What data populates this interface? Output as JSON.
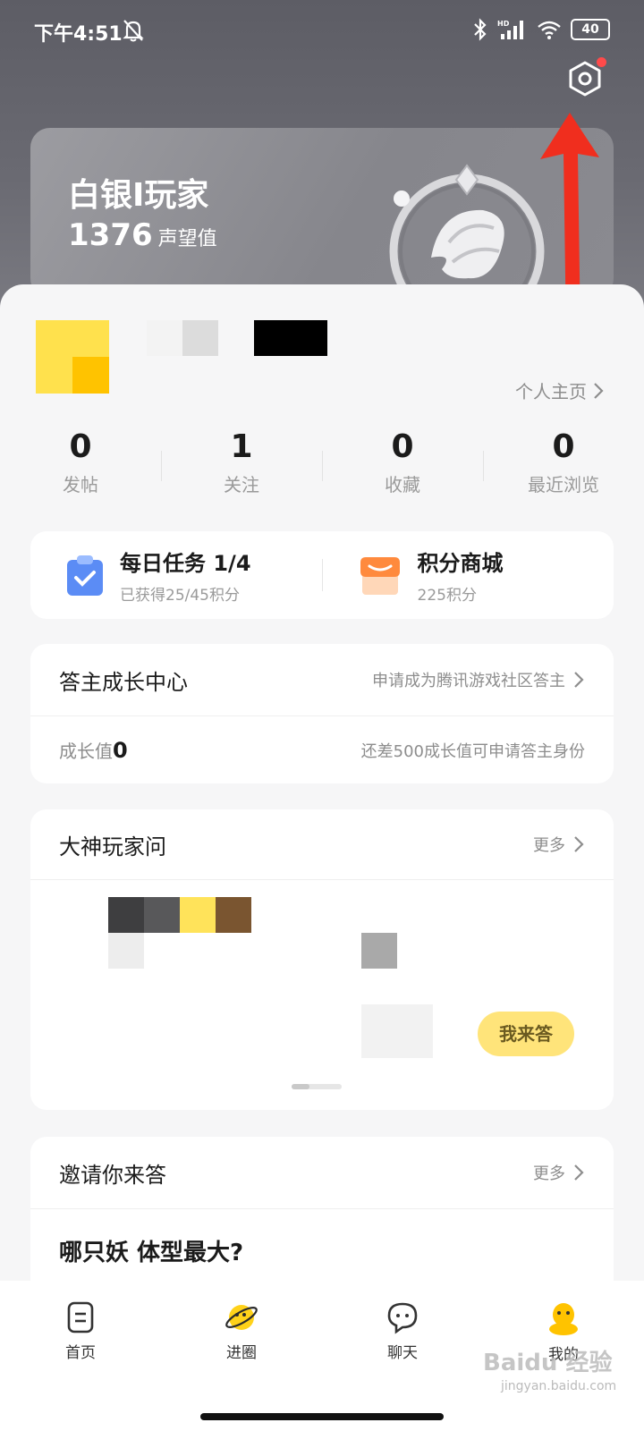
{
  "status": {
    "time": "下午4:51",
    "battery": "40",
    "net_label": "HD"
  },
  "rank": {
    "title": "白银I玩家",
    "value": "1376",
    "unit": "声望值"
  },
  "profile": {
    "link": "个人主页"
  },
  "stats": [
    {
      "value": "0",
      "label": "发帖"
    },
    {
      "value": "1",
      "label": "关注"
    },
    {
      "value": "0",
      "label": "收藏"
    },
    {
      "value": "0",
      "label": "最近浏览"
    }
  ],
  "tasks": {
    "daily": {
      "title": "每日任务 1/4",
      "sub": "已获得25/45积分"
    },
    "shop": {
      "title": "积分商城",
      "sub": "225积分"
    }
  },
  "growth": {
    "title": "答主成长中心",
    "apply": "申请成为腾讯游戏社区答主",
    "value_label": "成长值",
    "value": "0",
    "hint": "还差500成长值可申请答主身份"
  },
  "ask": {
    "title": "大神玩家问",
    "more": "更多",
    "answer_button": "我来答"
  },
  "invite": {
    "title": "邀请你来答",
    "more": "更多",
    "question": "哪只妖 体型最大?"
  },
  "tabs": [
    {
      "label": "首页"
    },
    {
      "label": "进圈"
    },
    {
      "label": "聊天"
    },
    {
      "label": "我的"
    }
  ],
  "watermark": {
    "text": "Baidu 经验",
    "sub": "jingyan.baidu.com"
  },
  "colors": {
    "accent": "#ffc300",
    "arrow": "#f02e1e",
    "header": "#66666e"
  }
}
